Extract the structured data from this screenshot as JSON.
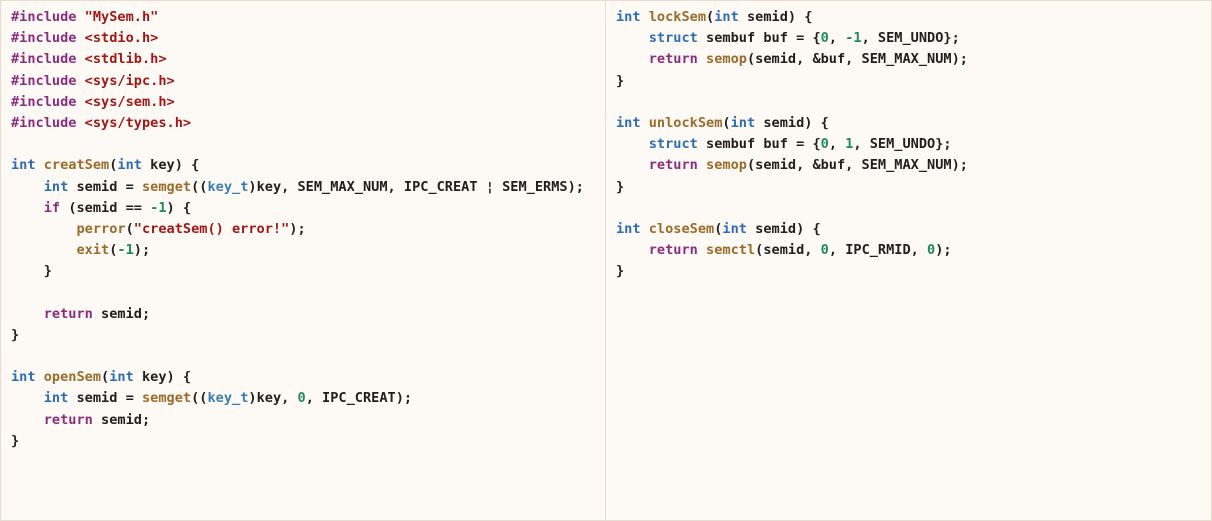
{
  "left_code": [
    [
      {
        "t": "#include ",
        "c": "pp"
      },
      {
        "t": "\"MySem.h\"",
        "c": "str"
      }
    ],
    [
      {
        "t": "#include ",
        "c": "pp"
      },
      {
        "t": "<stdio.h>",
        "c": "str"
      }
    ],
    [
      {
        "t": "#include ",
        "c": "pp"
      },
      {
        "t": "<stdlib.h>",
        "c": "str"
      }
    ],
    [
      {
        "t": "#include ",
        "c": "pp"
      },
      {
        "t": "<sys/ipc.h>",
        "c": "str"
      }
    ],
    [
      {
        "t": "#include ",
        "c": "pp"
      },
      {
        "t": "<sys/sem.h>",
        "c": "str"
      }
    ],
    [
      {
        "t": "#include ",
        "c": "pp"
      },
      {
        "t": "<sys/types.h>",
        "c": "str"
      }
    ],
    [],
    [
      {
        "t": "int ",
        "c": "kw"
      },
      {
        "t": "creatSem",
        "c": "fn"
      },
      {
        "t": "(",
        "c": "plain"
      },
      {
        "t": "int ",
        "c": "kw"
      },
      {
        "t": "key) {",
        "c": "plain"
      }
    ],
    [
      {
        "t": "    ",
        "c": "plain"
      },
      {
        "t": "int ",
        "c": "kw"
      },
      {
        "t": "semid = ",
        "c": "plain"
      },
      {
        "t": "semget",
        "c": "fn"
      },
      {
        "t": "((",
        "c": "plain"
      },
      {
        "t": "key_t",
        "c": "ty"
      },
      {
        "t": ")key, SEM_MAX_NUM, IPC_CREAT ¦ SEM_ERMS);",
        "c": "plain"
      }
    ],
    [
      {
        "t": "    ",
        "c": "plain"
      },
      {
        "t": "if ",
        "c": "ret"
      },
      {
        "t": "(semid == ",
        "c": "plain"
      },
      {
        "t": "-1",
        "c": "num"
      },
      {
        "t": ") {",
        "c": "plain"
      }
    ],
    [
      {
        "t": "        ",
        "c": "plain"
      },
      {
        "t": "perror",
        "c": "fn"
      },
      {
        "t": "(",
        "c": "plain"
      },
      {
        "t": "\"creatSem() error!\"",
        "c": "str"
      },
      {
        "t": ");",
        "c": "plain"
      }
    ],
    [
      {
        "t": "        ",
        "c": "plain"
      },
      {
        "t": "exit",
        "c": "fn"
      },
      {
        "t": "(",
        "c": "plain"
      },
      {
        "t": "-1",
        "c": "num"
      },
      {
        "t": ");",
        "c": "plain"
      }
    ],
    [
      {
        "t": "    }",
        "c": "plain"
      }
    ],
    [],
    [
      {
        "t": "    ",
        "c": "plain"
      },
      {
        "t": "return ",
        "c": "ret"
      },
      {
        "t": "semid;",
        "c": "plain"
      }
    ],
    [
      {
        "t": "}",
        "c": "plain"
      }
    ],
    [],
    [
      {
        "t": "int ",
        "c": "kw"
      },
      {
        "t": "openSem",
        "c": "fn"
      },
      {
        "t": "(",
        "c": "plain"
      },
      {
        "t": "int ",
        "c": "kw"
      },
      {
        "t": "key) {",
        "c": "plain"
      }
    ],
    [
      {
        "t": "    ",
        "c": "plain"
      },
      {
        "t": "int ",
        "c": "kw"
      },
      {
        "t": "semid = ",
        "c": "plain"
      },
      {
        "t": "semget",
        "c": "fn"
      },
      {
        "t": "((",
        "c": "plain"
      },
      {
        "t": "key_t",
        "c": "ty"
      },
      {
        "t": ")key, ",
        "c": "plain"
      },
      {
        "t": "0",
        "c": "num"
      },
      {
        "t": ", IPC_CREAT);",
        "c": "plain"
      }
    ],
    [
      {
        "t": "    ",
        "c": "plain"
      },
      {
        "t": "return ",
        "c": "ret"
      },
      {
        "t": "semid;",
        "c": "plain"
      }
    ],
    [
      {
        "t": "}",
        "c": "plain"
      }
    ]
  ],
  "right_code": [
    [
      {
        "t": "int ",
        "c": "kw"
      },
      {
        "t": "lockSem",
        "c": "fn"
      },
      {
        "t": "(",
        "c": "plain"
      },
      {
        "t": "int ",
        "c": "kw"
      },
      {
        "t": "semid) {",
        "c": "plain"
      }
    ],
    [
      {
        "t": "    ",
        "c": "plain"
      },
      {
        "t": "struct ",
        "c": "kw"
      },
      {
        "t": "sembuf buf = {",
        "c": "plain"
      },
      {
        "t": "0",
        "c": "num"
      },
      {
        "t": ", ",
        "c": "plain"
      },
      {
        "t": "-1",
        "c": "num"
      },
      {
        "t": ", SEM_UNDO};",
        "c": "plain"
      }
    ],
    [
      {
        "t": "    ",
        "c": "plain"
      },
      {
        "t": "return ",
        "c": "ret"
      },
      {
        "t": "semop",
        "c": "fn"
      },
      {
        "t": "(semid, &buf, SEM_MAX_NUM);",
        "c": "plain"
      }
    ],
    [
      {
        "t": "}",
        "c": "plain"
      }
    ],
    [],
    [
      {
        "t": "int ",
        "c": "kw"
      },
      {
        "t": "unlockSem",
        "c": "fn"
      },
      {
        "t": "(",
        "c": "plain"
      },
      {
        "t": "int ",
        "c": "kw"
      },
      {
        "t": "semid) {",
        "c": "plain"
      }
    ],
    [
      {
        "t": "    ",
        "c": "plain"
      },
      {
        "t": "struct ",
        "c": "kw"
      },
      {
        "t": "sembuf buf = {",
        "c": "plain"
      },
      {
        "t": "0",
        "c": "num"
      },
      {
        "t": ", ",
        "c": "plain"
      },
      {
        "t": "1",
        "c": "num"
      },
      {
        "t": ", SEM_UNDO};",
        "c": "plain"
      }
    ],
    [
      {
        "t": "    ",
        "c": "plain"
      },
      {
        "t": "return ",
        "c": "ret"
      },
      {
        "t": "semop",
        "c": "fn"
      },
      {
        "t": "(semid, &buf, SEM_MAX_NUM);",
        "c": "plain"
      }
    ],
    [
      {
        "t": "}",
        "c": "plain"
      }
    ],
    [],
    [
      {
        "t": "int ",
        "c": "kw"
      },
      {
        "t": "closeSem",
        "c": "fn"
      },
      {
        "t": "(",
        "c": "plain"
      },
      {
        "t": "int ",
        "c": "kw"
      },
      {
        "t": "semid) {",
        "c": "plain"
      }
    ],
    [
      {
        "t": "    ",
        "c": "plain"
      },
      {
        "t": "return ",
        "c": "ret"
      },
      {
        "t": "semctl",
        "c": "fn"
      },
      {
        "t": "(semid, ",
        "c": "plain"
      },
      {
        "t": "0",
        "c": "num"
      },
      {
        "t": ", IPC_RMID, ",
        "c": "plain"
      },
      {
        "t": "0",
        "c": "num"
      },
      {
        "t": ");",
        "c": "plain"
      }
    ],
    [
      {
        "t": "}",
        "c": "plain"
      }
    ]
  ]
}
